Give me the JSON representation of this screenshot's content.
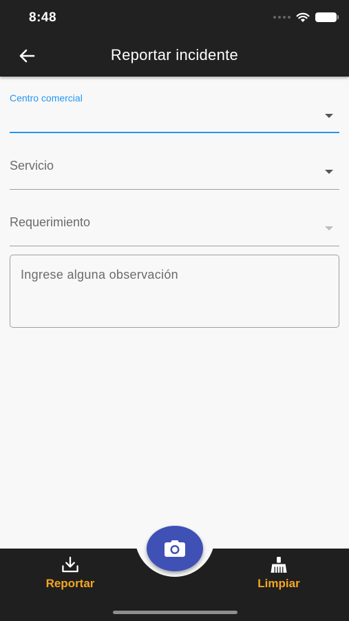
{
  "status_bar": {
    "time": "8:48"
  },
  "app_bar": {
    "title": "Reportar incidente"
  },
  "form": {
    "centro_comercial": {
      "label": "Centro comercial",
      "value": ""
    },
    "servicio": {
      "label": "Servicio"
    },
    "requerimiento": {
      "label": "Requerimiento"
    },
    "observacion": {
      "placeholder": "Ingrese alguna observación",
      "value": ""
    }
  },
  "bottom_nav": {
    "reportar": {
      "label": "Reportar",
      "icon": "download-icon"
    },
    "camera": {
      "icon": "camera-icon"
    },
    "limpiar": {
      "label": "Limpiar",
      "icon": "broom-icon"
    }
  },
  "colors": {
    "app_bar": "#212121",
    "accent": "#2196f3",
    "fab": "#3f51b5",
    "nav_label": "#f5a623"
  }
}
